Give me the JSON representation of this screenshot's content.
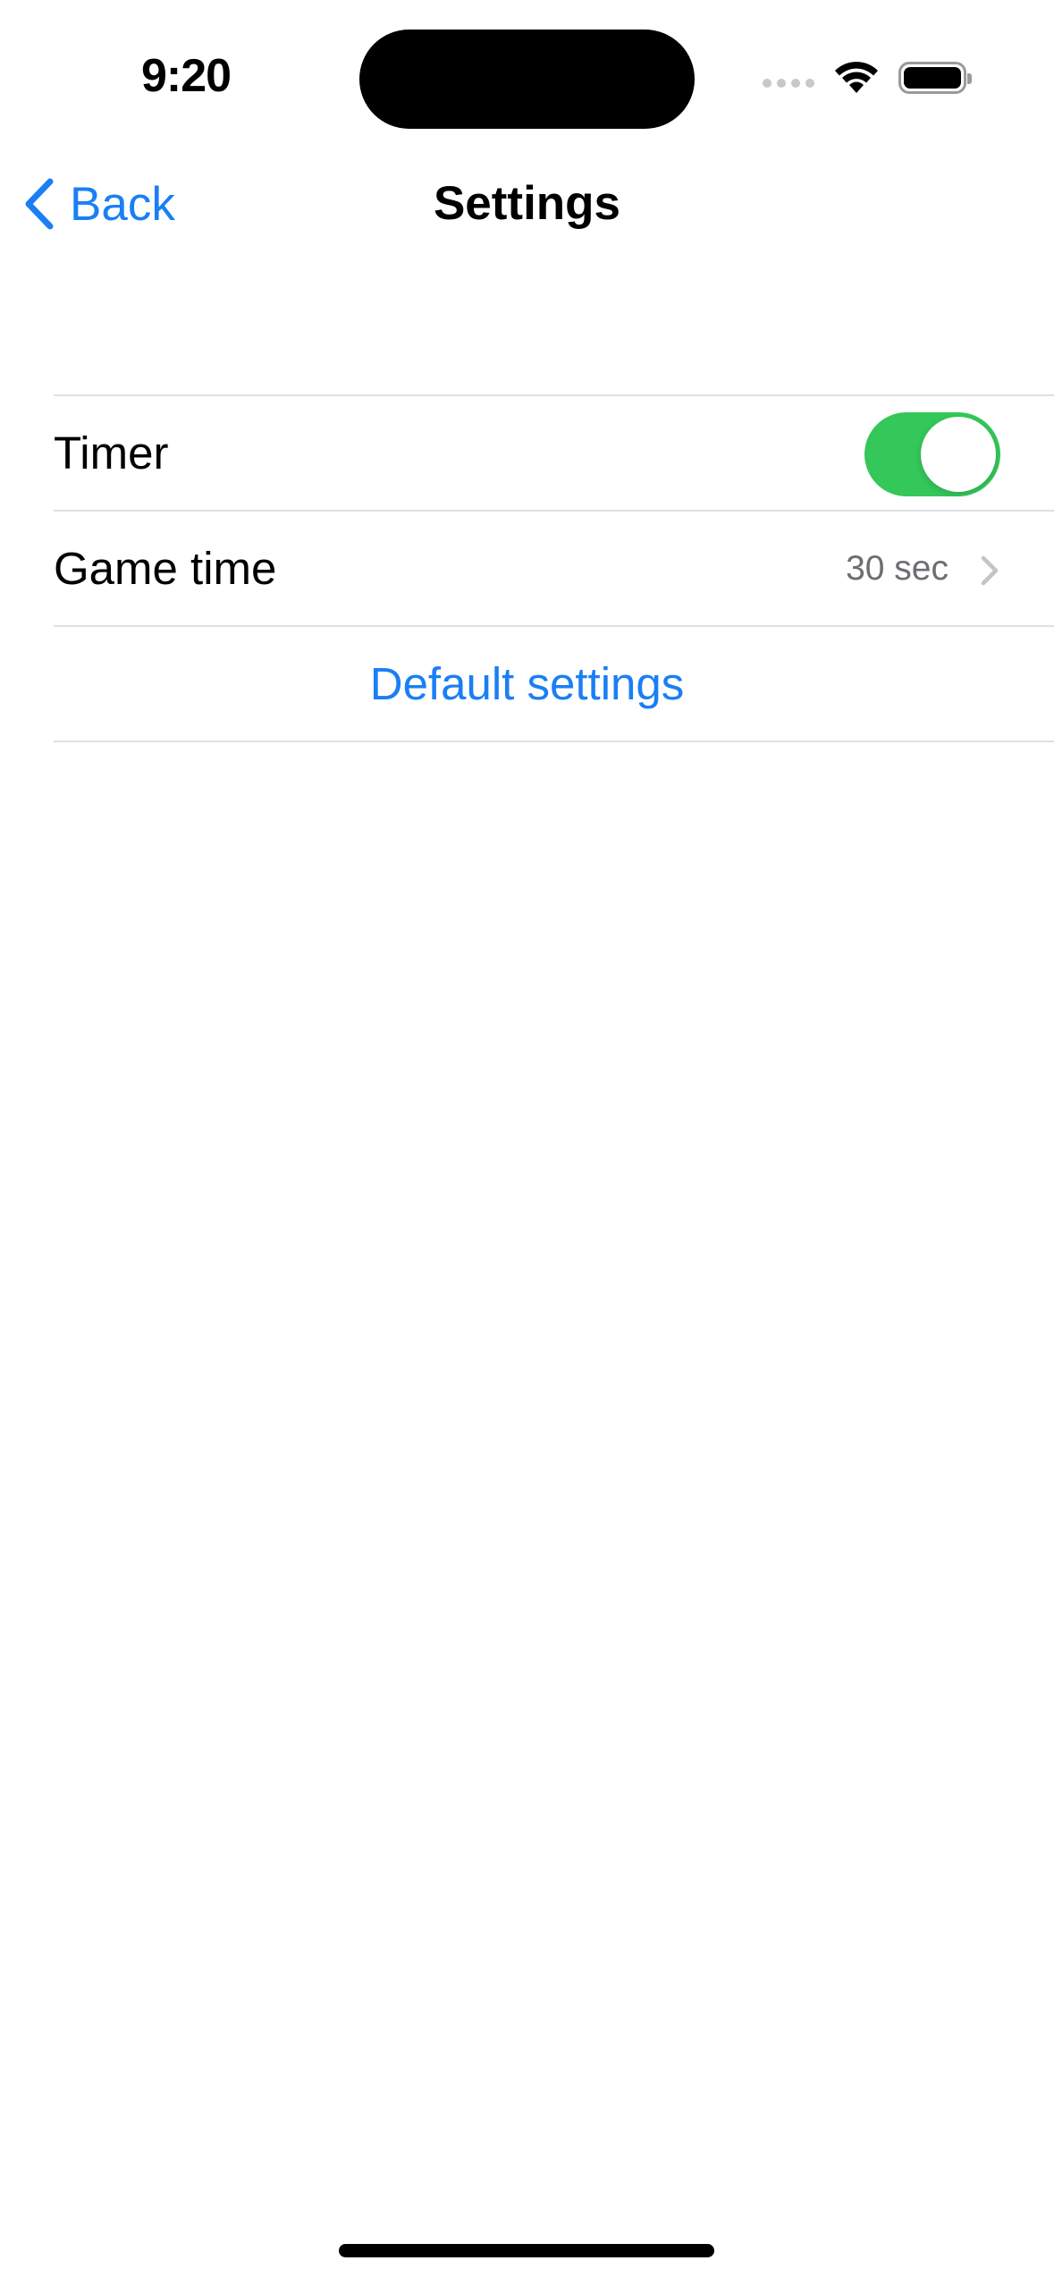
{
  "status_bar": {
    "time": "9:20",
    "icons": [
      "cellular-signal-icon",
      "wifi-icon",
      "battery-icon"
    ]
  },
  "nav": {
    "back_label": "Back",
    "title": "Settings"
  },
  "settings": {
    "timer": {
      "label": "Timer",
      "enabled": true
    },
    "game_time": {
      "label": "Game time",
      "value": "30 sec"
    },
    "default_settings_label": "Default settings"
  },
  "colors": {
    "accent": "#1a7ff5",
    "toggle_on": "#34c759",
    "separator": "#e0e0e3",
    "secondary_text": "#6d6d72"
  }
}
